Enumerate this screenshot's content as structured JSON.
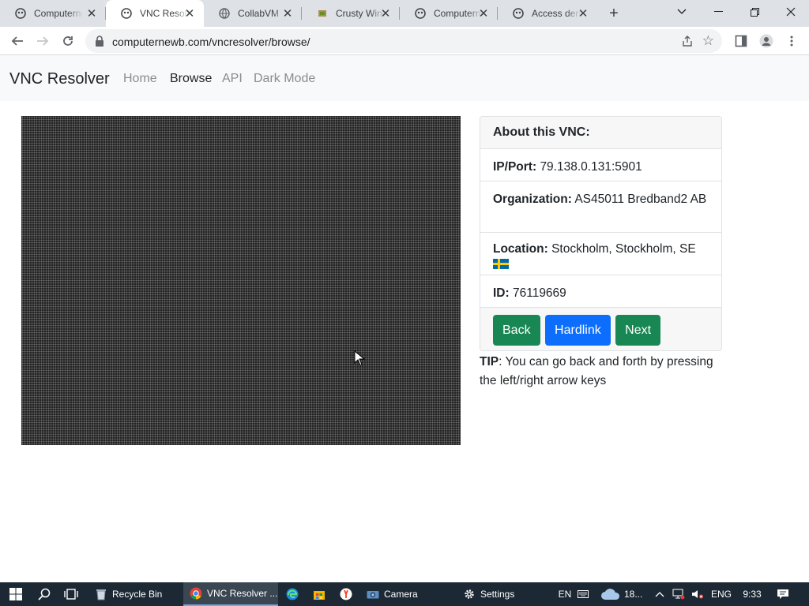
{
  "browser": {
    "tabs": [
      {
        "title": "Computernewb",
        "icon": "logo-icon",
        "active": false
      },
      {
        "title": "VNC Resolver",
        "icon": "logo-icon",
        "active": true
      },
      {
        "title": "CollabVM",
        "icon": "globe-icon",
        "active": false
      },
      {
        "title": "Crusty Windows",
        "icon": "crusty-icon",
        "active": false
      },
      {
        "title": "Computernewb",
        "icon": "logo-icon",
        "active": false
      },
      {
        "title": "Access denied",
        "icon": "logo-icon",
        "active": false
      }
    ],
    "url": "computernewb.com/vncresolver/browse/"
  },
  "site": {
    "brand": "VNC Resolver",
    "nav": [
      "Home",
      "Browse",
      "API",
      "Dark Mode"
    ],
    "active_nav": "Browse"
  },
  "info": {
    "header": "About this VNC:",
    "ip_label": "IP/Port:",
    "ip_value": "79.138.0.131:5901",
    "org_label": "Organization:",
    "org_value": "AS45011 Bredband2 AB",
    "loc_label": "Location:",
    "loc_value": "Stockholm, Stockholm, SE",
    "flag": "SE",
    "id_label": "ID:",
    "id_value": "76119669"
  },
  "buttons": {
    "back": "Back",
    "hardlink": "Hardlink",
    "next": "Next"
  },
  "tip": {
    "label": "TIP",
    "text": ": You can go back and forth by pressing the left/right arrow keys"
  },
  "taskbar": {
    "recycle": "Recycle Bin",
    "chrome": "VNC Resolver ...",
    "camera": "Camera",
    "settings": "Settings",
    "lang_short": "EN",
    "weather": "18...",
    "lang": "ENG",
    "time": "9:33"
  },
  "colors": {
    "green": "#198754",
    "blue": "#0d6efd",
    "taskbar": "#1c2833"
  }
}
